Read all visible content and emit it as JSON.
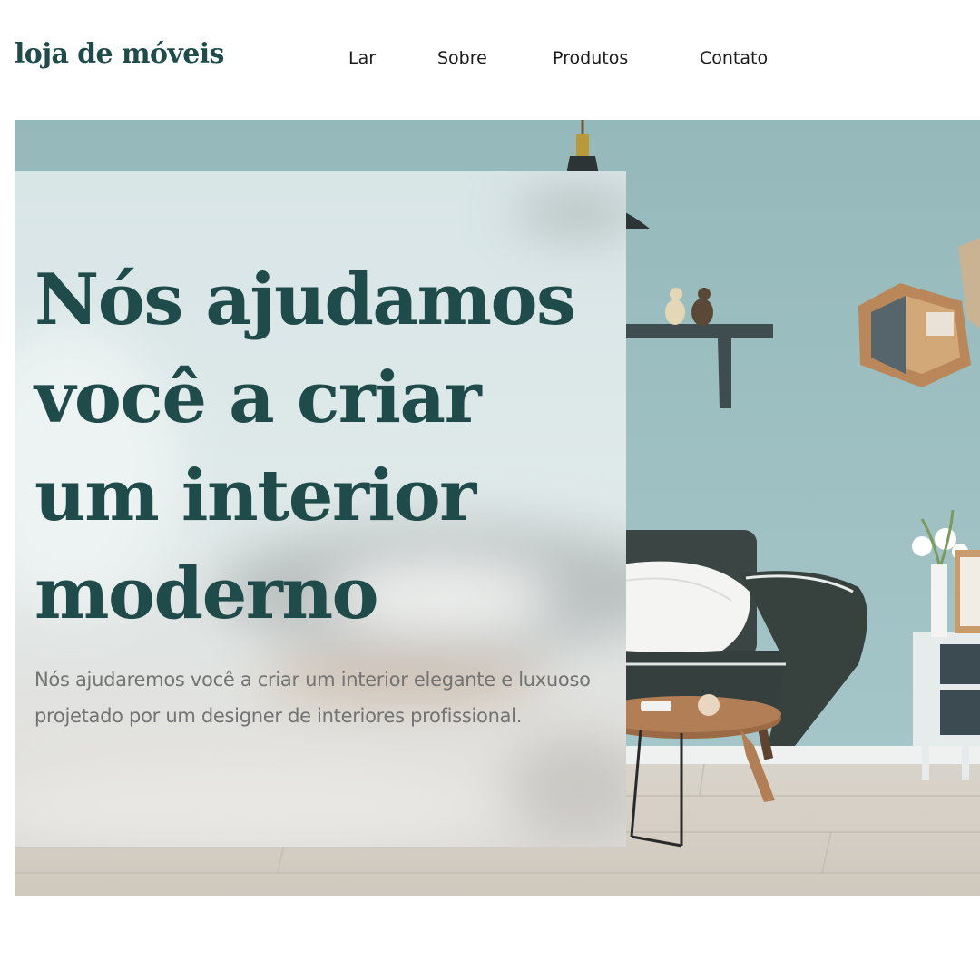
{
  "header": {
    "logo": "loja de móveis",
    "nav": [
      {
        "label": "Lar"
      },
      {
        "label": "Sobre"
      },
      {
        "label": "Produtos"
      },
      {
        "label": "Contato"
      }
    ]
  },
  "hero": {
    "title": "Nós ajudamos você a criar um interior moderno",
    "subtitle": "Nós ajudaremos você a criar um interior elegante e luxuoso projetado por um designer de interiores profissional.",
    "image": "living-room-photo"
  },
  "colors": {
    "brand": "#1f4c4a",
    "wall": "#9dc0c2",
    "sofa": "#36403f",
    "floor": "#dcd6ce",
    "text_muted": "#737373"
  }
}
